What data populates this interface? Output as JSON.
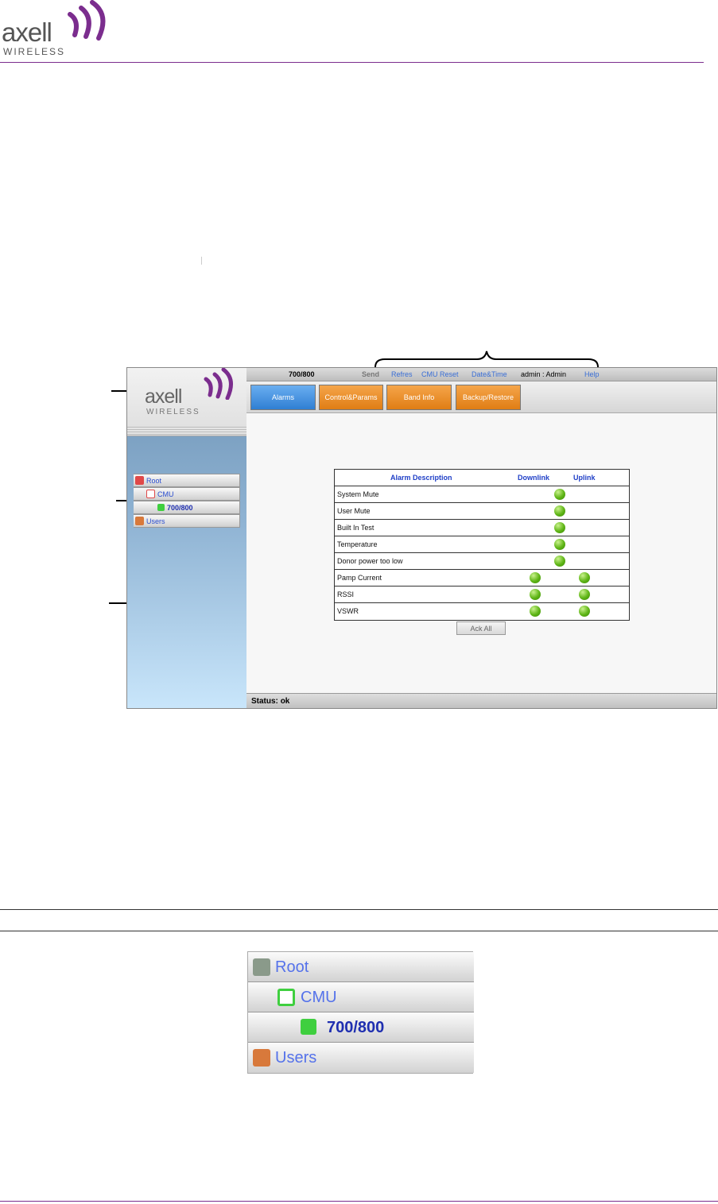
{
  "doc": {
    "logo_word": "axell",
    "logo_sub": "WIRELESS"
  },
  "screenshot": {
    "logo_word": "axell",
    "logo_sub": "WIRELESS",
    "topbar": {
      "device": "700/800",
      "send": "Send",
      "refresh": "Refres",
      "cmu_reset": "CMU Reset",
      "datetime": "Date&Time",
      "user": "admin : Admin",
      "help": "Help"
    },
    "tabs": [
      "Alarms",
      "Control&Params",
      "Band Info",
      "Backup/Restore"
    ],
    "tree": [
      "Root",
      "CMU",
      "700/800",
      "Users"
    ],
    "alarms": {
      "headers": [
        "Alarm Description",
        "Downlink",
        "Uplink"
      ],
      "rows": [
        {
          "label": "System Mute",
          "downlink": false,
          "center": true,
          "uplink": false
        },
        {
          "label": "User Mute",
          "downlink": false,
          "center": true,
          "uplink": false
        },
        {
          "label": "Built In Test",
          "downlink": false,
          "center": true,
          "uplink": false
        },
        {
          "label": "Temperature",
          "downlink": false,
          "center": true,
          "uplink": false
        },
        {
          "label": "Donor power too low",
          "downlink": false,
          "center": true,
          "uplink": false
        },
        {
          "label": "Pamp Current",
          "downlink": true,
          "center": false,
          "uplink": true
        },
        {
          "label": "RSSI",
          "downlink": true,
          "center": false,
          "uplink": true
        },
        {
          "label": "VSWR",
          "downlink": true,
          "center": false,
          "uplink": true
        }
      ],
      "ack_all": "Ack All"
    },
    "status": {
      "label": "Status:",
      "value": "ok"
    }
  },
  "tree_enlarged": [
    "Root",
    "CMU",
    "700/800",
    "Users"
  ],
  "colors": {
    "accent": "#7b2d8e",
    "link": "#3a6fd6",
    "tab_active": "#2f7fd3",
    "tab_orange": "#e07d14",
    "led_green": "#5fb516"
  }
}
